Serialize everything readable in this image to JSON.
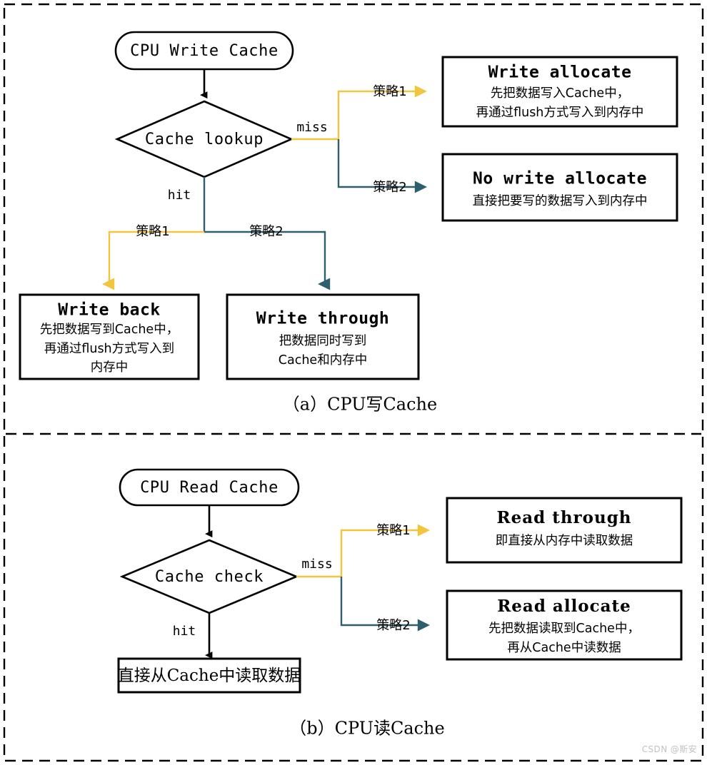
{
  "figure": {
    "watermark": "CSDN @斯安",
    "colors": {
      "policy1_yellow": "#F2C53D",
      "policy2_teal": "#2E5F6E",
      "line_black": "#000000",
      "background": "#FFFFFF"
    }
  },
  "section_a": {
    "caption": "（a）CPU写Cache",
    "start_node": "CPU Write Cache",
    "decision_node": "Cache lookup",
    "edge_miss": "miss",
    "edge_hit": "hit",
    "edge_policy1": "策略1",
    "edge_policy2": "策略2",
    "boxes": [
      {
        "title": "Write allocate",
        "lines": [
          "先把数据写入Cache中，",
          "再通过flush方式写入到内存中"
        ]
      },
      {
        "title": "No write allocate",
        "lines": [
          "直接把要写的数据写入到内存中"
        ]
      },
      {
        "title": "Write back",
        "lines": [
          "先把数据写到Cache中，",
          "再通过flush方式写入到",
          "内存中"
        ]
      },
      {
        "title": "Write through",
        "lines": [
          "把数据同时写到",
          "Cache和内存中"
        ]
      }
    ]
  },
  "section_b": {
    "caption": "（b）CPU读Cache",
    "start_node": "CPU Read Cache",
    "decision_node": "Cache check",
    "edge_miss": "miss",
    "edge_hit": "hit",
    "edge_policy1": "策略1",
    "edge_policy2": "策略2",
    "hit_box": "直接从Cache中读取数据",
    "boxes": [
      {
        "title": "Read through",
        "lines": [
          "即直接从内存中读取数据"
        ]
      },
      {
        "title": "Read allocate",
        "lines": [
          "先把数据读取到Cache中，",
          "再从Cache中读数据"
        ]
      }
    ]
  }
}
